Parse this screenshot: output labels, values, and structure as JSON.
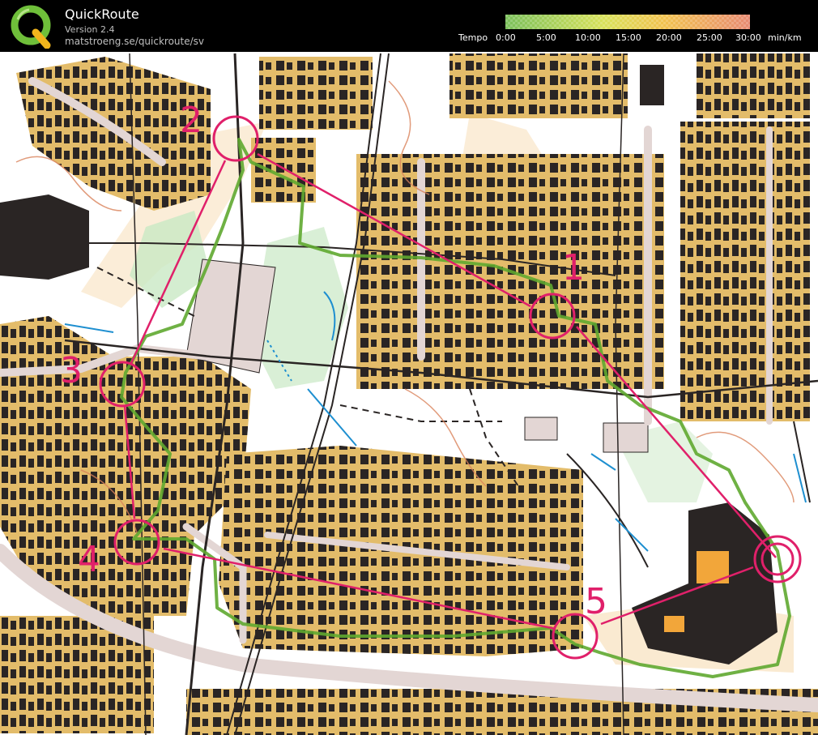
{
  "app": {
    "name": "QuickRoute",
    "version": "Version 2.4",
    "url": "matstroeng.se/quickroute/sv"
  },
  "tempo": {
    "label": "Tempo",
    "ticks": [
      "0:00",
      "5:00",
      "10:00",
      "15:00",
      "20:00",
      "25:00",
      "30:00"
    ],
    "unit": "min/km",
    "gradient_colors": [
      "#7ac05a",
      "#d8e25a",
      "#f2c24e",
      "#e88a72"
    ]
  },
  "map": {
    "controls": [
      "1",
      "2",
      "3",
      "4",
      "5"
    ],
    "colors": {
      "course": "#e0206a",
      "route": "#5fa830",
      "houses_yellow": "#e3bc6a",
      "open_land": "#f7dcb2",
      "building": "#2a2524",
      "paved": "#e3d6d4",
      "water": "#1e8fd0",
      "green": "#c9e8c4"
    }
  }
}
